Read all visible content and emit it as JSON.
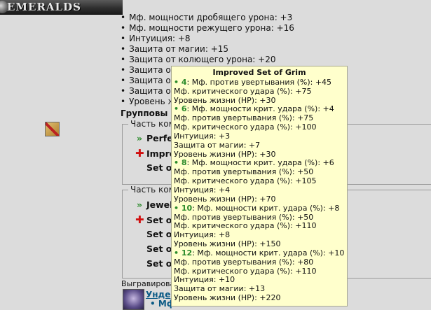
{
  "banner": {
    "title": "EMERALDS"
  },
  "stats": [
    "Мф. мощности дробящего урона: +3",
    "Мф. мощности режущего урона: +16",
    "Интуиция: +8",
    "Защита от магии: +15",
    "Защита от колющего урона: +20",
    "Защита от",
    "Защита от",
    "Защита от",
    "Уровень ж"
  ],
  "group_title": "Групповы",
  "set1": {
    "legend": "Часть ком",
    "items": [
      {
        "mark": "»",
        "label": "Perfec"
      },
      {
        "mark": "✚",
        "label": "Impro"
      },
      {
        "mark": "",
        "label": "Set of"
      }
    ]
  },
  "set2": {
    "legend": "Часть ком",
    "items": [
      {
        "mark": "»",
        "label": "Jewel"
      },
      {
        "mark": "✚",
        "label": "Set of"
      },
      {
        "mark": "",
        "label": "Set of"
      },
      {
        "mark": "",
        "label": "Set of"
      },
      {
        "mark": "",
        "label": "Set of"
      }
    ]
  },
  "engraved_label": "Выгравирован",
  "item": {
    "name": "Унде",
    "stat": "• Мф"
  },
  "tooltip": {
    "title": "Improved Set of Grim",
    "tiers": [
      {
        "count": "4",
        "lines": [
          "Мф. против увертывания (%): +45",
          "Мф. критического удара (%): +75",
          "Уровень жизни (HP): +30"
        ]
      },
      {
        "count": "6",
        "lines": [
          "Мф. мощности крит. удара (%): +4",
          "Мф. против увертывания (%): +75",
          "Мф. критического удара (%): +100",
          "Интуиция: +3",
          "Защита от магии: +7",
          "Уровень жизни (HP): +30"
        ]
      },
      {
        "count": "8",
        "lines": [
          "Мф. мощности крит. удара (%): +6",
          "Мф. против увертывания (%): +50",
          "Мф. критического удара (%): +105",
          "Интуиция: +4",
          "Уровень жизни (HP): +70"
        ]
      },
      {
        "count": "10",
        "lines": [
          "Мф. мощности крит. удара (%): +8",
          "Мф. против увертывания (%): +50",
          "Мф. критического удара (%): +110",
          "Интуиция: +8",
          "Уровень жизни (HP): +150"
        ]
      },
      {
        "count": "12",
        "lines": [
          "Мф. мощности крит. удара (%): +10",
          "Мф. против увертывания (%): +80",
          "Мф. критического удара (%): +110",
          "Интуиция: +10",
          "Защита от магии: +13",
          "Уровень жизни (HP): +220"
        ]
      }
    ]
  }
}
